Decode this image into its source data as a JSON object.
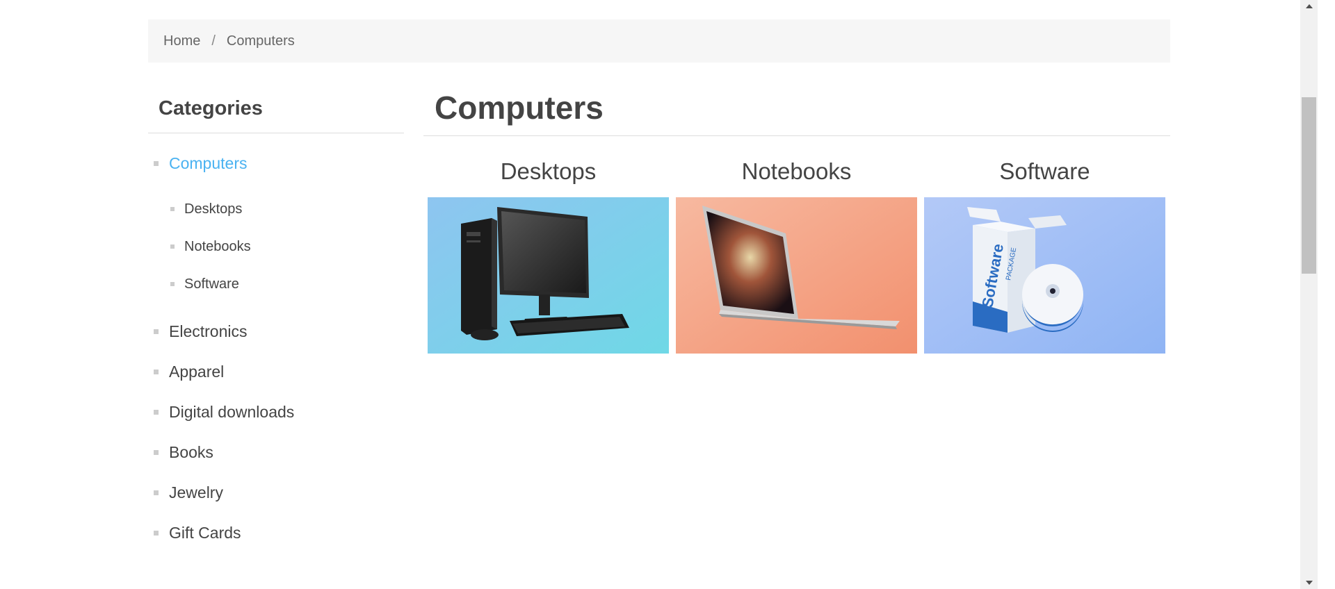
{
  "breadcrumb": {
    "home": "Home",
    "separator": "/",
    "current": "Computers"
  },
  "sidebar": {
    "title": "Categories",
    "active_color": "#4ab2f1",
    "items": [
      {
        "label": "Computers",
        "active": true,
        "children": [
          {
            "label": "Desktops"
          },
          {
            "label": "Notebooks"
          },
          {
            "label": "Software"
          }
        ]
      },
      {
        "label": "Electronics"
      },
      {
        "label": "Apparel"
      },
      {
        "label": "Digital downloads"
      },
      {
        "label": "Books"
      },
      {
        "label": "Jewelry"
      },
      {
        "label": "Gift Cards"
      }
    ]
  },
  "main": {
    "title": "Computers",
    "subcategories": [
      {
        "title": "Desktops",
        "image": "desktop-computer-image"
      },
      {
        "title": "Notebooks",
        "image": "laptop-image"
      },
      {
        "title": "Software",
        "image": "software-box-image"
      }
    ]
  }
}
